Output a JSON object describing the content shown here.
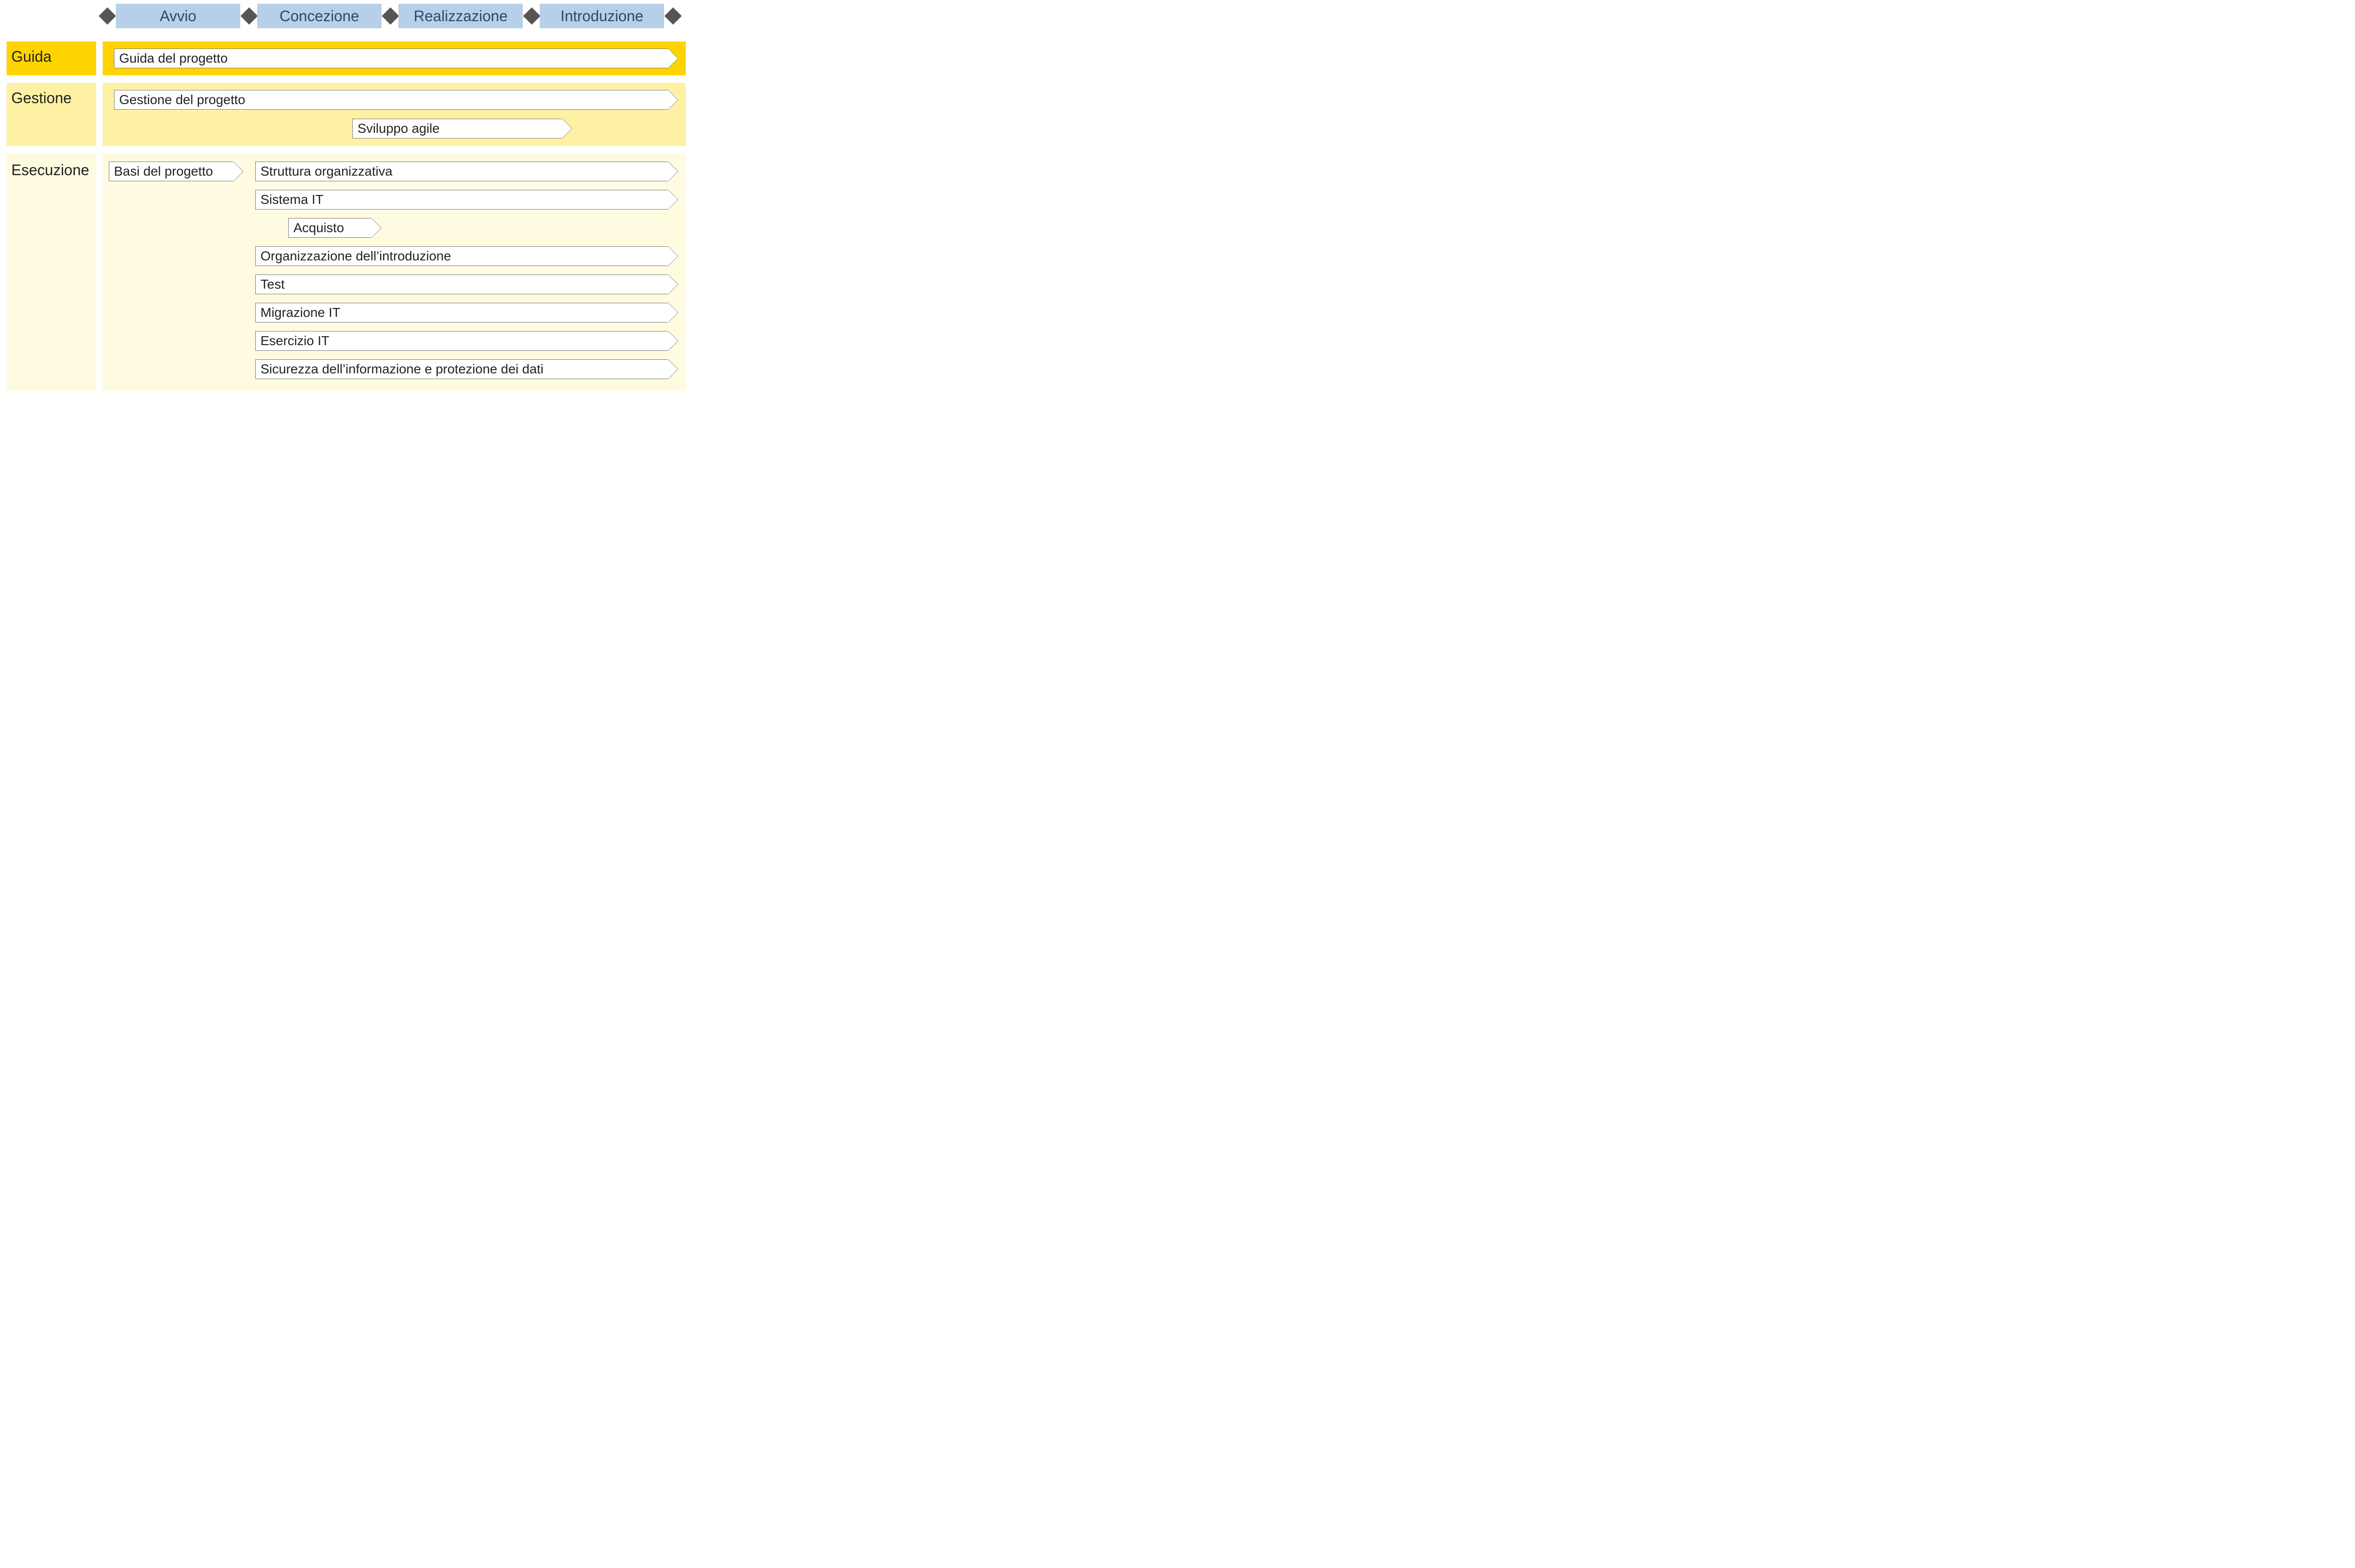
{
  "phases": {
    "p1": "Avvio",
    "p2": "Concezione",
    "p3": "Realizzazione",
    "p4": "Introduzione"
  },
  "rows": {
    "guida": "Guida",
    "gestione": "Gestione",
    "esecuzione": "Esecuzione"
  },
  "bars": {
    "guida_progetto": "Guida del progetto",
    "gestione_progetto": "Gestione del progetto",
    "sviluppo_agile": "Sviluppo agile",
    "basi_progetto": "Basi del progetto",
    "struttura_org": "Struttura organizzativa",
    "sistema_it": "Sistema IT",
    "acquisto": "Acquisto",
    "org_introduzione": "Organizzazione dell’introduzione",
    "test": "Test",
    "migrazione_it": "Migrazione IT",
    "esercizio_it": "Esercizio IT",
    "sicurezza": "Sicurezza dell’informazione e protezione dei dati"
  },
  "layout_note": "Project lifecycle matrix: columns = phases, rows = activity tracks. Arrow bars show which phases each activity spans."
}
